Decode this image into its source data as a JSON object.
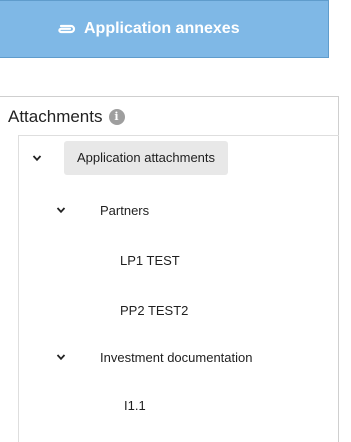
{
  "annex_button": {
    "label": "Application annexes",
    "icon": "paperclip-icon"
  },
  "attachments": {
    "title": "Attachments",
    "info_icon": "info-icon",
    "info_glyph": "i",
    "tree": {
      "root": {
        "label": "Application attachments",
        "expanded": true,
        "selected": true
      },
      "partners": {
        "label": "Partners",
        "expanded": true
      },
      "lp1": {
        "label": "LP1 TEST"
      },
      "pp2": {
        "label": "PP2 TEST2"
      },
      "investment": {
        "label": "Investment documentation",
        "expanded": true
      },
      "i11": {
        "label": "I1.1"
      }
    }
  },
  "colors": {
    "button_bg": "#7fb8e6",
    "button_text": "#ffffff",
    "selected_bg": "#e8e8e8"
  }
}
